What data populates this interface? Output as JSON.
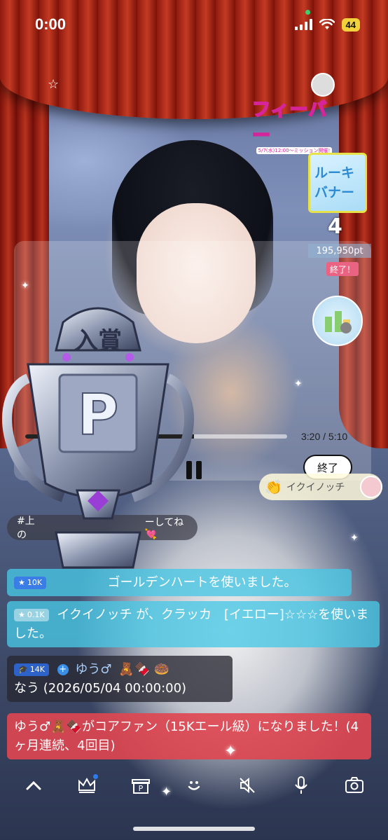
{
  "status_bar": {
    "time": "0:00",
    "battery": "44"
  },
  "banners": {
    "fever_title": "フィーバー",
    "fever_sub": "5/7(水)12:00〜ミッション開催!",
    "rookie_line1": "ルーキ",
    "rookie_line2": "バナー",
    "rank": "4",
    "points": "195,950pt",
    "ended": "終了！"
  },
  "player": {
    "progress_label": "3:20 / 5:10",
    "progress": 0.645,
    "end_button": "終了",
    "user_chip_name": "イクイノッチ"
  },
  "hashtag": {
    "text_left": "#上の",
    "text_right": "ーしてね 💘"
  },
  "comments": [
    {
      "badge": "10K",
      "text": "ゴールデンハートを使いました。"
    },
    {
      "badge": "0.1K",
      "text": "イクイノッチ が、クラッカ　[イエロー]☆☆☆を使いました。"
    },
    {
      "badge": "14K",
      "user": "ゆう♂",
      "emojis": "🧸🍫 🍩",
      "text": "なう (2026/05/04 00:00:00)"
    },
    {
      "text": "ゆう♂🧸🍫がコアファン（15Kエール級）になりました！(4ヶ月連続、4回目)"
    }
  ],
  "trophy": {
    "label": "入賞"
  },
  "icons": {
    "star": "star-icon",
    "crown": "crown-icon",
    "gift": "gift-icon",
    "smile": "smile-icon",
    "mute": "speaker-mute-icon",
    "mic": "mic-off-icon",
    "camera": "camera-rotate-icon"
  },
  "colors": {
    "curtain": "#b8321e",
    "cyan_comment": "#48c8e6",
    "red_comment": "#e04650",
    "fever_pink": "#d6249b"
  }
}
